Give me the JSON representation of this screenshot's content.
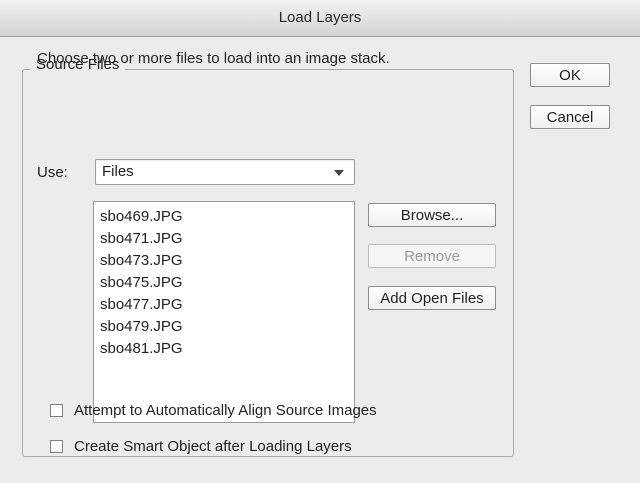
{
  "window": {
    "title": "Load Layers"
  },
  "source_files": {
    "legend": "Source Files",
    "description": "Choose two or more files to load into an image stack.",
    "use_label": "Use:",
    "use_selected": "Files",
    "files": [
      "sbo469.JPG",
      "sbo471.JPG",
      "sbo473.JPG",
      "sbo475.JPG",
      "sbo477.JPG",
      "sbo479.JPG",
      "sbo481.JPG"
    ],
    "browse_label": "Browse...",
    "remove_label": "Remove",
    "add_open_files_label": "Add Open Files"
  },
  "options": {
    "align_label": "Attempt to Automatically Align Source Images",
    "align_checked": false,
    "smart_object_label": "Create Smart Object after Loading Layers",
    "smart_object_checked": false
  },
  "actions": {
    "ok_label": "OK",
    "cancel_label": "Cancel"
  }
}
